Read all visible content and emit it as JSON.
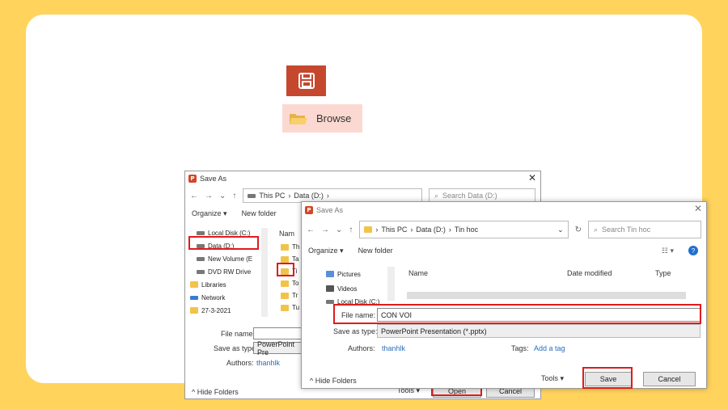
{
  "colors": {
    "accent_red": "#c5482e",
    "highlight_box": "#e01b1b",
    "folder": "#f2c34b",
    "link": "#2a6ebb"
  },
  "tiles": {
    "browse_label": "Browse"
  },
  "back_dialog": {
    "title": "Save As",
    "breadcrumb": [
      "This PC",
      "Data (D:)"
    ],
    "search_placeholder": "Search Data (D:)",
    "organize": "Organize",
    "new_folder": "New folder",
    "tree": [
      "Local Disk (C:)",
      "Data (D:)",
      "New Volume (E",
      "DVD RW Drive",
      "Libraries",
      "Network",
      "27-3-2021"
    ],
    "col_name": "Nam",
    "file_items": [
      "Th",
      "Ta",
      "Ti",
      "To",
      "Tr",
      "Tu"
    ],
    "file_name_label": "File name:",
    "save_type_label": "Save as type:",
    "save_type_value": "PowerPoint Pre",
    "authors_label": "Authors:",
    "authors_value": "thanhlk",
    "hide_folders": "Hide Folders",
    "tools": "Tools",
    "open": "Open",
    "cancel": "Cancel"
  },
  "front_dialog": {
    "title": "Save As",
    "breadcrumb": [
      "This PC",
      "Data (D:)",
      "Tin hoc"
    ],
    "search_placeholder": "Search Tin hoc",
    "organize": "Organize",
    "new_folder": "New folder",
    "tree": [
      "Pictures",
      "Videos",
      "Local Disk (C:)"
    ],
    "columns": {
      "name": "Name",
      "date_modified": "Date modified",
      "type": "Type"
    },
    "file_name_label": "File name:",
    "file_name_value": "CON VOI",
    "save_type_label": "Save as type:",
    "save_type_value": "PowerPoint Presentation (*.pptx)",
    "authors_label": "Authors:",
    "authors_value": "thanhlk",
    "tags_label": "Tags:",
    "tags_value": "Add a tag",
    "hide_folders": "Hide Folders",
    "tools": "Tools",
    "save": "Save",
    "cancel": "Cancel"
  }
}
